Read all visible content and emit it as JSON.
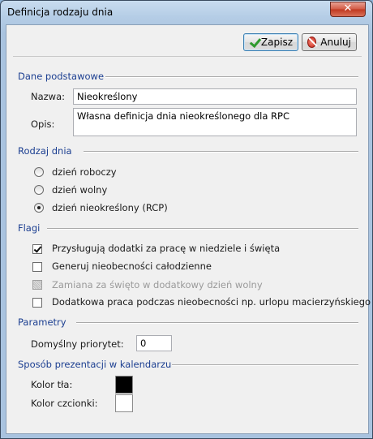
{
  "window": {
    "title": "Definicja rodzaju dnia",
    "close_label": "✕"
  },
  "toolbar": {
    "save_label": "Zapisz",
    "cancel_label": "Anuluj"
  },
  "basic": {
    "section_title": "Dane podstawowe",
    "name_label": "Nazwa:",
    "name_value": "Nieokreślony",
    "desc_label": "Opis:",
    "desc_value": "Własna definicja dnia nieokreślonego dla RPC"
  },
  "day_type": {
    "section_title": "Rodzaj dnia",
    "options": [
      {
        "label": "dzień roboczy",
        "checked": false
      },
      {
        "label": "dzień wolny",
        "checked": false
      },
      {
        "label": "dzień nieokreślony (RCP)",
        "checked": true
      }
    ]
  },
  "flags": {
    "section_title": "Flagi",
    "items": [
      {
        "label": "Przysługują dodatki za pracę w niedziele i święta",
        "state": "checked"
      },
      {
        "label": "Generuj nieobecności całodzienne",
        "state": "unchecked"
      },
      {
        "label": "Zamiana za święto w dodatkowy dzień wolny",
        "state": "disabled"
      },
      {
        "label": "Dodatkowa praca podczas nieobecności np. urlopu macierzyńskiego",
        "state": "unchecked"
      }
    ]
  },
  "params": {
    "section_title": "Parametry",
    "priority_label": "Domyślny priorytet:",
    "priority_value": "0"
  },
  "calendar": {
    "section_title": "Sposób prezentacji w kalendarzu",
    "bg_label": "Kolor tła:",
    "bg_color": "#000000",
    "font_label": "Kolor czcionki:",
    "font_color": "#ffffff"
  },
  "colors": {
    "section_text": "#1c3f91",
    "titlebar": "#b5cde6",
    "close_button": "#c7432b"
  }
}
